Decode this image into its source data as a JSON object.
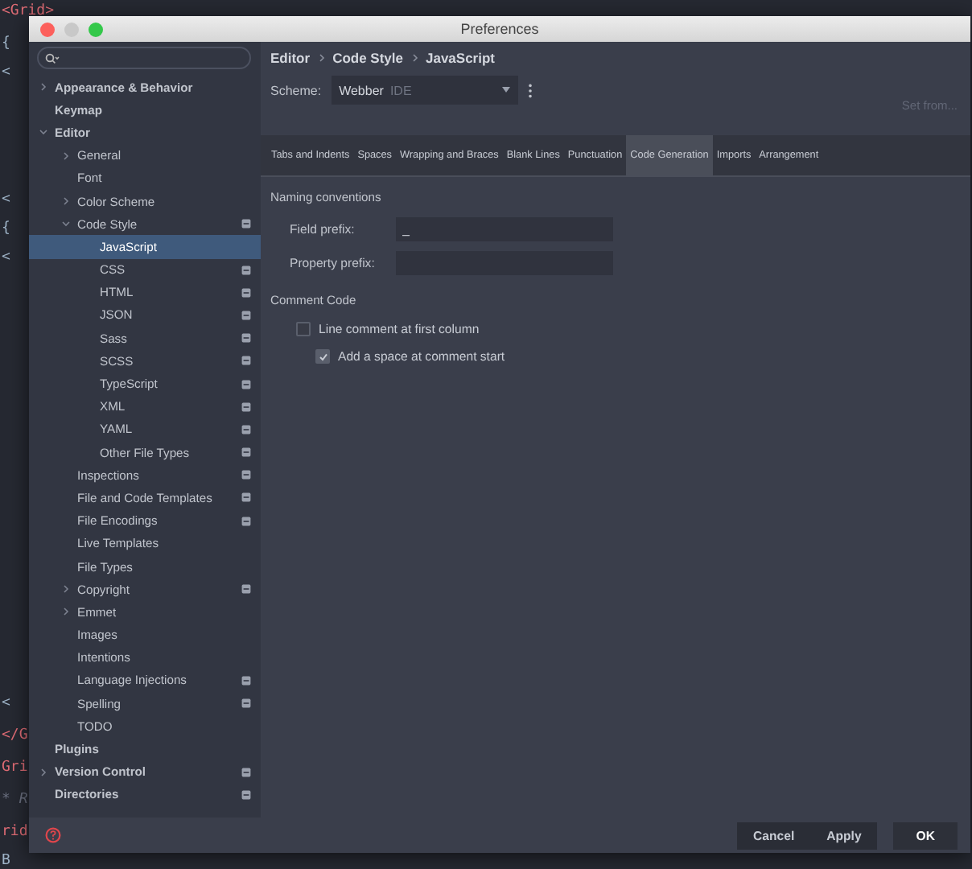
{
  "editor_lines": [
    {
      "text": "<Grid>",
      "kind": "tag"
    },
    {
      "text": "{",
      "kind": "plain"
    },
    {
      "text": "<",
      "kind": "plain"
    },
    {
      "text": "<",
      "kind": "plain"
    },
    {
      "text": "{",
      "kind": "plain"
    },
    {
      "text": "<",
      "kind": "plain"
    },
    {
      "text": "<",
      "kind": "plain"
    },
    {
      "text": "</G",
      "kind": "tag"
    },
    {
      "text": "Gri",
      "kind": "tag"
    },
    {
      "text": "* R",
      "kind": "comment"
    },
    {
      "text": "rid",
      "kind": "tag"
    },
    {
      "text": "B",
      "kind": "plain"
    }
  ],
  "window": {
    "title": "Preferences"
  },
  "tree": [
    {
      "label": "Appearance & Behavior",
      "bold": true,
      "expandable": true,
      "expanded": false,
      "badge": false,
      "selected": false
    },
    {
      "label": "Keymap",
      "bold": true,
      "expandable": false,
      "badge": false,
      "selected": false
    },
    {
      "label": "Editor",
      "bold": true,
      "expandable": true,
      "expanded": true,
      "badge": false,
      "selected": false,
      "children": [
        {
          "label": "General",
          "bold": false,
          "expandable": true,
          "expanded": false,
          "badge": false,
          "selected": false
        },
        {
          "label": "Font",
          "bold": false,
          "expandable": false,
          "badge": false,
          "selected": false
        },
        {
          "label": "Color Scheme",
          "bold": false,
          "expandable": true,
          "expanded": false,
          "badge": false,
          "selected": false
        },
        {
          "label": "Code Style",
          "bold": false,
          "expandable": true,
          "expanded": true,
          "badge": true,
          "selected": false,
          "children": [
            {
              "label": "JavaScript",
              "bold": false,
              "expandable": false,
              "badge": false,
              "selected": true
            },
            {
              "label": "CSS",
              "bold": false,
              "expandable": false,
              "badge": true,
              "selected": false
            },
            {
              "label": "HTML",
              "bold": false,
              "expandable": false,
              "badge": true,
              "selected": false
            },
            {
              "label": "JSON",
              "bold": false,
              "expandable": false,
              "badge": true,
              "selected": false
            },
            {
              "label": "Sass",
              "bold": false,
              "expandable": false,
              "badge": true,
              "selected": false
            },
            {
              "label": "SCSS",
              "bold": false,
              "expandable": false,
              "badge": true,
              "selected": false
            },
            {
              "label": "TypeScript",
              "bold": false,
              "expandable": false,
              "badge": true,
              "selected": false
            },
            {
              "label": "XML",
              "bold": false,
              "expandable": false,
              "badge": true,
              "selected": false
            },
            {
              "label": "YAML",
              "bold": false,
              "expandable": false,
              "badge": true,
              "selected": false
            },
            {
              "label": "Other File Types",
              "bold": false,
              "expandable": false,
              "badge": true,
              "selected": false
            }
          ]
        },
        {
          "label": "Inspections",
          "bold": false,
          "expandable": false,
          "badge": true,
          "selected": false
        },
        {
          "label": "File and Code Templates",
          "bold": false,
          "expandable": false,
          "badge": true,
          "selected": false
        },
        {
          "label": "File Encodings",
          "bold": false,
          "expandable": false,
          "badge": true,
          "selected": false
        },
        {
          "label": "Live Templates",
          "bold": false,
          "expandable": false,
          "badge": false,
          "selected": false
        },
        {
          "label": "File Types",
          "bold": false,
          "expandable": false,
          "badge": false,
          "selected": false
        },
        {
          "label": "Copyright",
          "bold": false,
          "expandable": true,
          "expanded": false,
          "badge": true,
          "selected": false
        },
        {
          "label": "Emmet",
          "bold": false,
          "expandable": true,
          "expanded": false,
          "badge": false,
          "selected": false
        },
        {
          "label": "Images",
          "bold": false,
          "expandable": false,
          "badge": false,
          "selected": false
        },
        {
          "label": "Intentions",
          "bold": false,
          "expandable": false,
          "badge": false,
          "selected": false
        },
        {
          "label": "Language Injections",
          "bold": false,
          "expandable": false,
          "badge": true,
          "selected": false
        },
        {
          "label": "Spelling",
          "bold": false,
          "expandable": false,
          "badge": true,
          "selected": false
        },
        {
          "label": "TODO",
          "bold": false,
          "expandable": false,
          "badge": false,
          "selected": false
        }
      ]
    },
    {
      "label": "Plugins",
      "bold": true,
      "expandable": false,
      "badge": false,
      "selected": false
    },
    {
      "label": "Version Control",
      "bold": true,
      "expandable": true,
      "expanded": false,
      "badge": true,
      "selected": false
    },
    {
      "label": "Directories",
      "bold": true,
      "expandable": false,
      "badge": true,
      "selected": false
    }
  ],
  "breadcrumb": [
    "Editor",
    "Code Style",
    "JavaScript"
  ],
  "scheme": {
    "label": "Scheme:",
    "name": "Webber",
    "tag": "IDE"
  },
  "set_from": "Set from...",
  "tabs": [
    {
      "label": "Tabs and Indents",
      "selected": false
    },
    {
      "label": "Spaces",
      "selected": false
    },
    {
      "label": "Wrapping and Braces",
      "selected": false
    },
    {
      "label": "Blank Lines",
      "selected": false
    },
    {
      "label": "Punctuation",
      "selected": false
    },
    {
      "label": "Code Generation",
      "selected": true
    },
    {
      "label": "Imports",
      "selected": false
    },
    {
      "label": "Arrangement",
      "selected": false
    }
  ],
  "sections": [
    {
      "title": "Naming conventions",
      "items": [
        {
          "kind": "field",
          "label": "Field prefix:",
          "value": "_"
        },
        {
          "kind": "field",
          "label": "Property prefix:"
        }
      ]
    },
    {
      "title": "Comment Code",
      "items": [
        {
          "kind": "checkbox",
          "label": "Line comment at first column",
          "checked": false,
          "children": [
            {
              "kind": "checkbox",
              "label": "Add a space at comment start",
              "checked": true
            }
          ]
        }
      ]
    }
  ],
  "buttons": [
    {
      "label": "Cancel",
      "kind": "secondary"
    },
    {
      "label": "Apply",
      "kind": "secondary"
    },
    {
      "label": "OK",
      "kind": "default"
    }
  ]
}
